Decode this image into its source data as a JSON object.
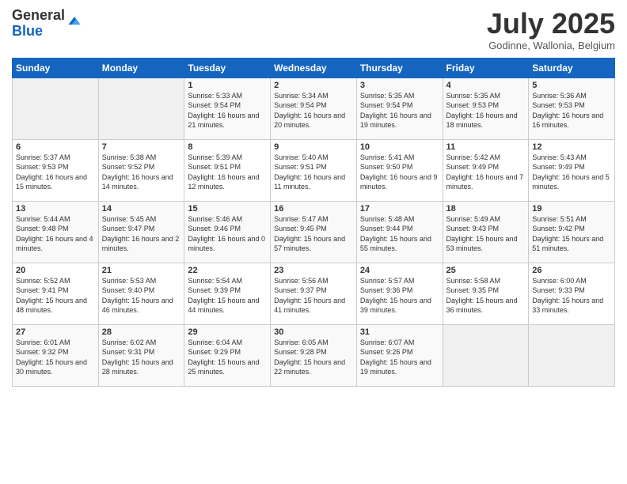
{
  "logo": {
    "general": "General",
    "blue": "Blue"
  },
  "title": "July 2025",
  "subtitle": "Godinne, Wallonia, Belgium",
  "days_of_week": [
    "Sunday",
    "Monday",
    "Tuesday",
    "Wednesday",
    "Thursday",
    "Friday",
    "Saturday"
  ],
  "weeks": [
    [
      {
        "day": "",
        "sunrise": "",
        "sunset": "",
        "daylight": ""
      },
      {
        "day": "",
        "sunrise": "",
        "sunset": "",
        "daylight": ""
      },
      {
        "day": "1",
        "sunrise": "Sunrise: 5:33 AM",
        "sunset": "Sunset: 9:54 PM",
        "daylight": "Daylight: 16 hours and 21 minutes."
      },
      {
        "day": "2",
        "sunrise": "Sunrise: 5:34 AM",
        "sunset": "Sunset: 9:54 PM",
        "daylight": "Daylight: 16 hours and 20 minutes."
      },
      {
        "day": "3",
        "sunrise": "Sunrise: 5:35 AM",
        "sunset": "Sunset: 9:54 PM",
        "daylight": "Daylight: 16 hours and 19 minutes."
      },
      {
        "day": "4",
        "sunrise": "Sunrise: 5:35 AM",
        "sunset": "Sunset: 9:53 PM",
        "daylight": "Daylight: 16 hours and 18 minutes."
      },
      {
        "day": "5",
        "sunrise": "Sunrise: 5:36 AM",
        "sunset": "Sunset: 9:53 PM",
        "daylight": "Daylight: 16 hours and 16 minutes."
      }
    ],
    [
      {
        "day": "6",
        "sunrise": "Sunrise: 5:37 AM",
        "sunset": "Sunset: 9:53 PM",
        "daylight": "Daylight: 16 hours and 15 minutes."
      },
      {
        "day": "7",
        "sunrise": "Sunrise: 5:38 AM",
        "sunset": "Sunset: 9:52 PM",
        "daylight": "Daylight: 16 hours and 14 minutes."
      },
      {
        "day": "8",
        "sunrise": "Sunrise: 5:39 AM",
        "sunset": "Sunset: 9:51 PM",
        "daylight": "Daylight: 16 hours and 12 minutes."
      },
      {
        "day": "9",
        "sunrise": "Sunrise: 5:40 AM",
        "sunset": "Sunset: 9:51 PM",
        "daylight": "Daylight: 16 hours and 11 minutes."
      },
      {
        "day": "10",
        "sunrise": "Sunrise: 5:41 AM",
        "sunset": "Sunset: 9:50 PM",
        "daylight": "Daylight: 16 hours and 9 minutes."
      },
      {
        "day": "11",
        "sunrise": "Sunrise: 5:42 AM",
        "sunset": "Sunset: 9:49 PM",
        "daylight": "Daylight: 16 hours and 7 minutes."
      },
      {
        "day": "12",
        "sunrise": "Sunrise: 5:43 AM",
        "sunset": "Sunset: 9:49 PM",
        "daylight": "Daylight: 16 hours and 5 minutes."
      }
    ],
    [
      {
        "day": "13",
        "sunrise": "Sunrise: 5:44 AM",
        "sunset": "Sunset: 9:48 PM",
        "daylight": "Daylight: 16 hours and 4 minutes."
      },
      {
        "day": "14",
        "sunrise": "Sunrise: 5:45 AM",
        "sunset": "Sunset: 9:47 PM",
        "daylight": "Daylight: 16 hours and 2 minutes."
      },
      {
        "day": "15",
        "sunrise": "Sunrise: 5:46 AM",
        "sunset": "Sunset: 9:46 PM",
        "daylight": "Daylight: 16 hours and 0 minutes."
      },
      {
        "day": "16",
        "sunrise": "Sunrise: 5:47 AM",
        "sunset": "Sunset: 9:45 PM",
        "daylight": "Daylight: 15 hours and 57 minutes."
      },
      {
        "day": "17",
        "sunrise": "Sunrise: 5:48 AM",
        "sunset": "Sunset: 9:44 PM",
        "daylight": "Daylight: 15 hours and 55 minutes."
      },
      {
        "day": "18",
        "sunrise": "Sunrise: 5:49 AM",
        "sunset": "Sunset: 9:43 PM",
        "daylight": "Daylight: 15 hours and 53 minutes."
      },
      {
        "day": "19",
        "sunrise": "Sunrise: 5:51 AM",
        "sunset": "Sunset: 9:42 PM",
        "daylight": "Daylight: 15 hours and 51 minutes."
      }
    ],
    [
      {
        "day": "20",
        "sunrise": "Sunrise: 5:52 AM",
        "sunset": "Sunset: 9:41 PM",
        "daylight": "Daylight: 15 hours and 48 minutes."
      },
      {
        "day": "21",
        "sunrise": "Sunrise: 5:53 AM",
        "sunset": "Sunset: 9:40 PM",
        "daylight": "Daylight: 15 hours and 46 minutes."
      },
      {
        "day": "22",
        "sunrise": "Sunrise: 5:54 AM",
        "sunset": "Sunset: 9:39 PM",
        "daylight": "Daylight: 15 hours and 44 minutes."
      },
      {
        "day": "23",
        "sunrise": "Sunrise: 5:56 AM",
        "sunset": "Sunset: 9:37 PM",
        "daylight": "Daylight: 15 hours and 41 minutes."
      },
      {
        "day": "24",
        "sunrise": "Sunrise: 5:57 AM",
        "sunset": "Sunset: 9:36 PM",
        "daylight": "Daylight: 15 hours and 39 minutes."
      },
      {
        "day": "25",
        "sunrise": "Sunrise: 5:58 AM",
        "sunset": "Sunset: 9:35 PM",
        "daylight": "Daylight: 15 hours and 36 minutes."
      },
      {
        "day": "26",
        "sunrise": "Sunrise: 6:00 AM",
        "sunset": "Sunset: 9:33 PM",
        "daylight": "Daylight: 15 hours and 33 minutes."
      }
    ],
    [
      {
        "day": "27",
        "sunrise": "Sunrise: 6:01 AM",
        "sunset": "Sunset: 9:32 PM",
        "daylight": "Daylight: 15 hours and 30 minutes."
      },
      {
        "day": "28",
        "sunrise": "Sunrise: 6:02 AM",
        "sunset": "Sunset: 9:31 PM",
        "daylight": "Daylight: 15 hours and 28 minutes."
      },
      {
        "day": "29",
        "sunrise": "Sunrise: 6:04 AM",
        "sunset": "Sunset: 9:29 PM",
        "daylight": "Daylight: 15 hours and 25 minutes."
      },
      {
        "day": "30",
        "sunrise": "Sunrise: 6:05 AM",
        "sunset": "Sunset: 9:28 PM",
        "daylight": "Daylight: 15 hours and 22 minutes."
      },
      {
        "day": "31",
        "sunrise": "Sunrise: 6:07 AM",
        "sunset": "Sunset: 9:26 PM",
        "daylight": "Daylight: 15 hours and 19 minutes."
      },
      {
        "day": "",
        "sunrise": "",
        "sunset": "",
        "daylight": ""
      },
      {
        "day": "",
        "sunrise": "",
        "sunset": "",
        "daylight": ""
      }
    ]
  ]
}
